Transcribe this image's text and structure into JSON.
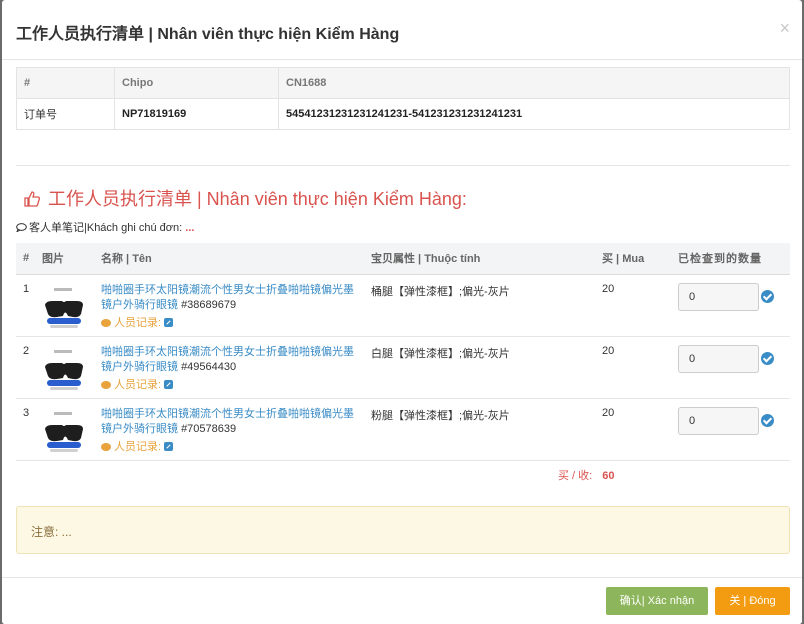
{
  "header": {
    "title": "工作人员执行清单 | Nhân viên thực hiện Kiểm Hàng",
    "close_glyph": "×"
  },
  "info_table": {
    "columns": [
      "#",
      "Chipo",
      "CN1688"
    ],
    "row": {
      "label": "订单号",
      "chipo": "NP71819169",
      "cn1688": "5454123123123124123​1-541231231231241231"
    }
  },
  "section": {
    "title": "工作人员执行清单 | Nhân viên thực hiện Kiểm Hàng:"
  },
  "customer_note": {
    "label": "客人单笔记|Khách ghi chú đơn:",
    "value": "..."
  },
  "items_table": {
    "headers": {
      "num": "#",
      "img": "图片",
      "name": "名称 | Tên",
      "attr": "宝贝属性 | Thuộc tính",
      "buy": "买 | Mua",
      "checked": "已检查到的数量"
    },
    "rows": [
      {
        "num": "1",
        "name": "啪啪圈手环太阳镜潮流个性男女士折叠啪啪镜偏光墨镜户外骑行眼镜",
        "sku": "#38689679",
        "staff_record": "人员记录:",
        "attr": "桶腿【弹性漆框】;偏光-灰片",
        "qty": "20",
        "checked_qty": "0"
      },
      {
        "num": "2",
        "name": "啪啪圈手环太阳镜潮流个性男女士折叠啪啪镜偏光墨镜户外骑行眼镜",
        "sku": "#49564430",
        "staff_record": "人员记录:",
        "attr": "白腿【弹性漆框】;偏光-灰片",
        "qty": "20",
        "checked_qty": "0"
      },
      {
        "num": "3",
        "name": "啪啪圈手环太阳镜潮流个性男女士折叠啪啪镜偏光墨镜户外骑行眼镜",
        "sku": "#70578639",
        "staff_record": "人员记录:",
        "attr": "粉腿【弹性漆框】;偏光-灰片",
        "qty": "20",
        "checked_qty": "0"
      }
    ]
  },
  "total": {
    "label": "买 / 收:",
    "value": "60"
  },
  "notice": {
    "text": "注意: ..."
  },
  "footer": {
    "confirm_label": "确认| Xác nhận",
    "close_label": "关 | Đóng"
  },
  "colors": {
    "accent_blue": "#3a8cc6",
    "danger": "#d9534f",
    "confirm": "#8db55b",
    "close": "#f39c12"
  }
}
